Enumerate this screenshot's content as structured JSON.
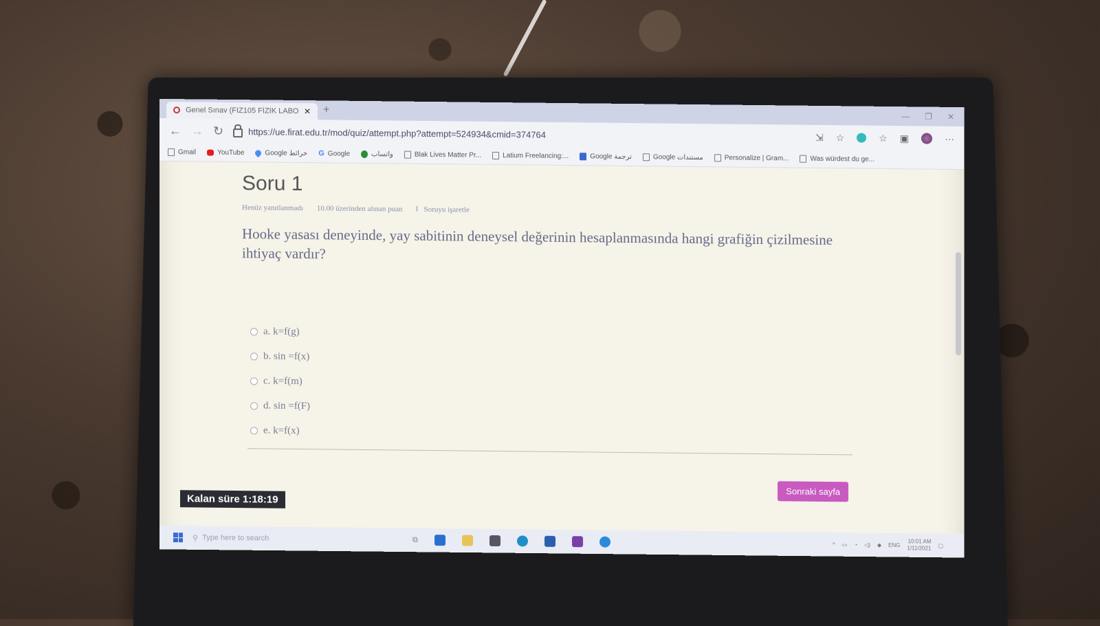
{
  "browser": {
    "tab_title": "Genel Sınav (FIZ105 FİZİK LABO...",
    "url": "https://ue.firat.edu.tr/mod/quiz/attempt.php?attempt=524934&cmid=374764",
    "bookmarks": [
      {
        "label": "Gmail",
        "icon": "page-icon"
      },
      {
        "label": "YouTube",
        "icon": "youtube-icon"
      },
      {
        "label": "Google خرائط",
        "icon": "maps-icon"
      },
      {
        "label": "Google",
        "icon": "google-icon"
      },
      {
        "label": "واتساب",
        "icon": "whatsapp-icon"
      },
      {
        "label": "Blak Lives Matter Pr...",
        "icon": "page-icon"
      },
      {
        "label": "Latium Freelancing:...",
        "icon": "page-icon"
      },
      {
        "label": "Google ترجمة",
        "icon": "translate-icon"
      },
      {
        "label": "Google مستندات",
        "icon": "page-icon"
      },
      {
        "label": "Personalize | Gram...",
        "icon": "page-icon"
      },
      {
        "label": "Was würdest du ge...",
        "icon": "page-icon"
      }
    ]
  },
  "quiz": {
    "title": "Soru 1",
    "status": "Henüz yanıtlanmadı",
    "points": "10.00 üzerinden alınan puan",
    "flag_label": "Soruyu işaretle",
    "question": "Hooke yasası deneyinde, yay sabitinin deneysel değerinin hesaplanmasında hangi grafiğin çizilmesine ihtiyaç vardır?",
    "answers": [
      "a. k=f(g)",
      "b. sin =f(x)",
      "c. k=f(m)",
      "d. sin =f(F)",
      "e. k=f(x)"
    ],
    "next_button": "Sonraki sayfa",
    "timer": "Kalan süre 1:18:19"
  },
  "taskbar": {
    "search_placeholder": "Type here to search",
    "lang": "ENG",
    "time": "10:01 AM",
    "date": "1/11/2021"
  }
}
